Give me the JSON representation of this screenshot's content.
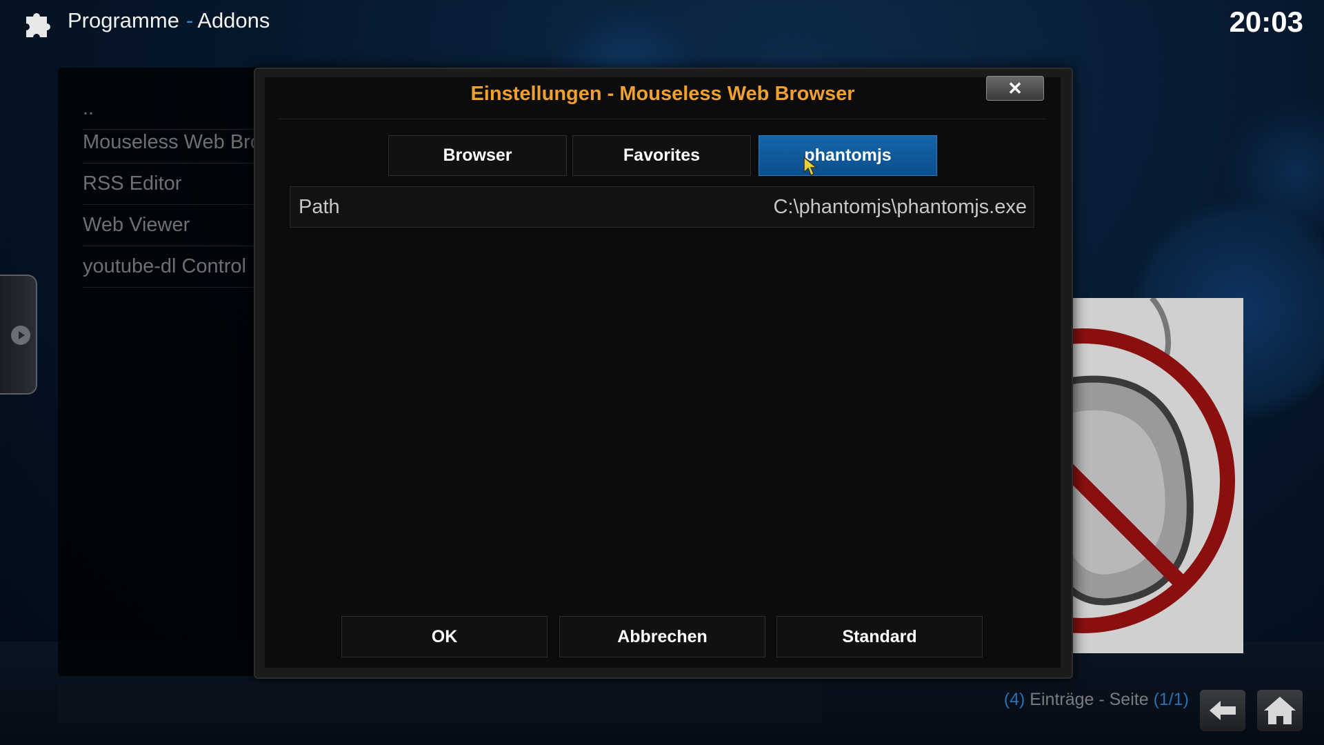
{
  "header": {
    "section": "Programme",
    "separator": "-",
    "subsection": "Addons",
    "clock": "20:03"
  },
  "addon_list": {
    "items": [
      {
        "label": ".."
      },
      {
        "label": "Mouseless Web Browser"
      },
      {
        "label": "RSS Editor"
      },
      {
        "label": "Web Viewer"
      },
      {
        "label": "youtube-dl Control"
      }
    ]
  },
  "dialog": {
    "title": "Einstellungen - Mouseless Web Browser",
    "close_label": "✕",
    "tabs": [
      {
        "label": "Browser",
        "active": false
      },
      {
        "label": "Favorites",
        "active": false
      },
      {
        "label": "phantomjs",
        "active": true
      }
    ],
    "settings": [
      {
        "label": "Path",
        "value": "C:\\phantomjs\\phantomjs.exe"
      }
    ],
    "buttons": {
      "ok": "OK",
      "cancel": "Abbrechen",
      "default": "Standard"
    }
  },
  "footer": {
    "count_open": "(",
    "count": "4",
    "count_close": ")",
    "entries_label": " Einträge - Seite ",
    "page_open": "(",
    "page": "1/1",
    "page_close": ")"
  },
  "colors": {
    "accent": "#f0a030",
    "active_tab": "#0b5a9e",
    "highlight_blue": "#2e8fd8"
  },
  "icons": {
    "header": "puzzle-piece-icon",
    "close": "close-icon",
    "back": "back-arrow-icon",
    "home": "home-icon"
  }
}
